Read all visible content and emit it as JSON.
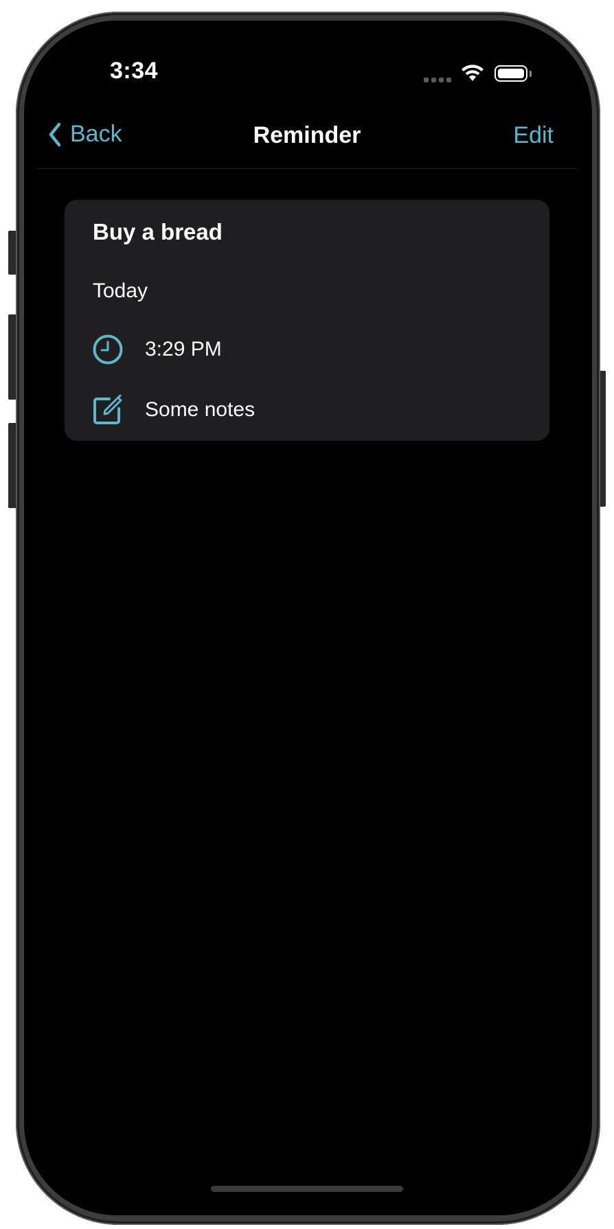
{
  "status_bar": {
    "time": "3:34"
  },
  "nav": {
    "back_label": "Back",
    "title": "Reminder",
    "edit_label": "Edit"
  },
  "reminder": {
    "title": "Buy a bread",
    "date": "Today",
    "time": "3:29 PM",
    "notes": "Some notes"
  },
  "icons": {
    "back": "chevron-left-icon",
    "time": "clock-icon",
    "notes": "edit-note-icon",
    "wifi": "wifi-icon",
    "battery": "battery-icon",
    "signal": "cellular-signal-icon"
  },
  "colors": {
    "accent": "#5ab7cd",
    "background": "#000000",
    "card": "#1f1f21",
    "text": "#ffffff"
  }
}
